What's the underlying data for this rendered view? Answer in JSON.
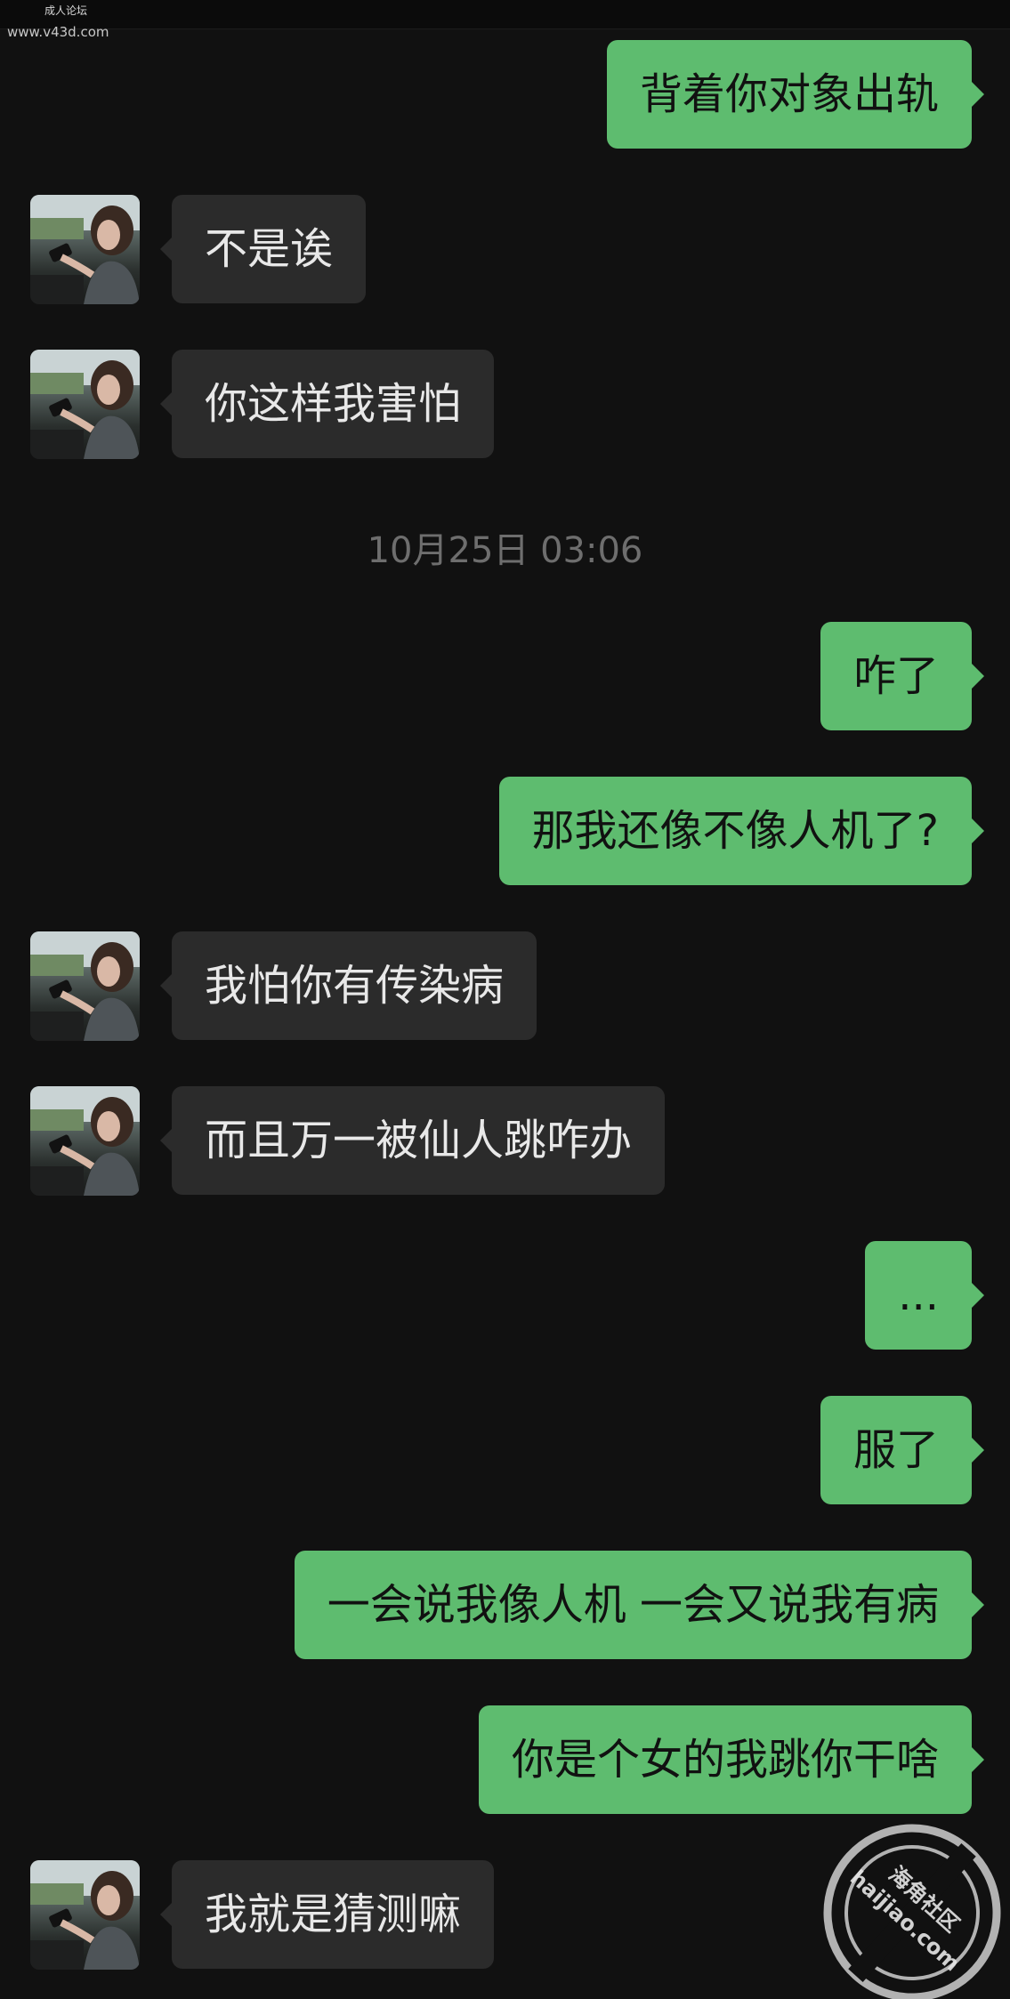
{
  "watermark": {
    "line1": "成人论坛",
    "line2": "www.v43d.com"
  },
  "messages": [
    {
      "side": "out",
      "text": "背着你对象出轨"
    },
    {
      "side": "in",
      "text": "不是诶"
    },
    {
      "side": "in",
      "text": "你这样我害怕"
    },
    {
      "side": "out",
      "text": "咋了"
    },
    {
      "side": "out",
      "text": "那我还像不像人机了?"
    },
    {
      "side": "in",
      "text": "我怕你有传染病"
    },
    {
      "side": "in",
      "text": "而且万一被仙人跳咋办"
    },
    {
      "side": "out",
      "text": "..."
    },
    {
      "side": "out",
      "text": "服了"
    },
    {
      "side": "out",
      "text": "一会说我像人机 一会又说我有病"
    },
    {
      "side": "out",
      "text": "你是个女的我跳你干啥"
    },
    {
      "side": "in",
      "text": "我就是猜测嘛"
    }
  ],
  "timestamp": "10月25日 03:06",
  "seal": {
    "top": "海角社区",
    "bottom": "haijiao.com"
  },
  "colors": {
    "background": "#111111",
    "incoming": "#2b2b2b",
    "outgoing": "#5ebc6f"
  },
  "icons": {
    "avatar": "avatar-photo-icon"
  }
}
